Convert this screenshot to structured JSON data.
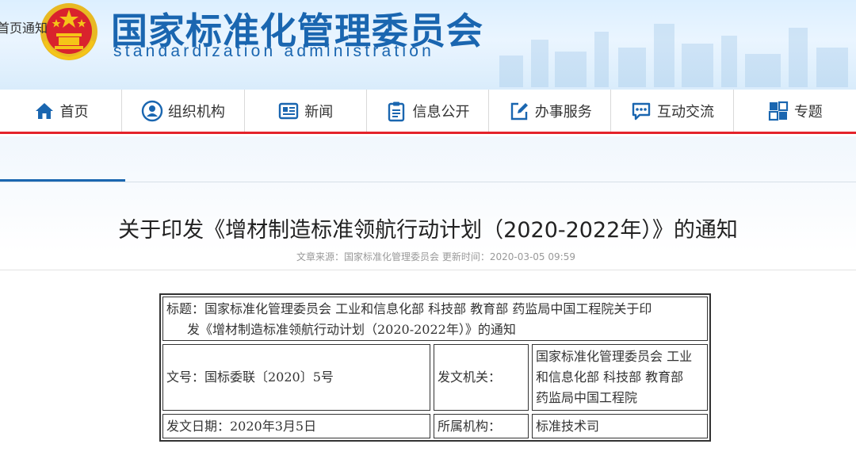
{
  "header": {
    "site_title": "国家标准化管理委员会",
    "site_subtitle": "standardization administration",
    "brand_color": "#1a66b0",
    "accent_color": "#e4232b"
  },
  "nav": {
    "items": [
      {
        "label": "首页",
        "icon": "home-icon"
      },
      {
        "label": "组织机构",
        "icon": "user-circle-icon"
      },
      {
        "label": "新闻",
        "icon": "newspaper-icon"
      },
      {
        "label": "信息公开",
        "icon": "clipboard-icon"
      },
      {
        "label": "办事服务",
        "icon": "edit-icon"
      },
      {
        "label": "互动交流",
        "icon": "chat-icon"
      },
      {
        "label": "专题",
        "icon": "topic-grid-icon"
      }
    ]
  },
  "breadcrumb": {
    "label": "首页通知"
  },
  "article": {
    "title": "关于印发《增材制造标准领航行动计划（2020-2022年）》的通知",
    "meta": "文章来源：国家标准化管理委员会 更新时间：2020-03-05 09:59"
  },
  "info_table": {
    "title_line1": "标题：国家标准化管理委员会 工业和信息化部 科技部 教育部 药监局中国工程院关于印",
    "title_line2": "发《增材制造标准领航行动计划（2020-2022年）》的通知",
    "doc_no": "文号：国标委联〔2020〕5号",
    "issuer_label": "发文机关：",
    "issuer_line1": "国家标准化管理委员会 工业",
    "issuer_line2": "和信息化部 科技部 教育部",
    "issuer_line3": "药监局中国工程院",
    "date": "发文日期：2020年3月5日",
    "dept_label": "所属机构：",
    "dept": "标准技术司"
  }
}
